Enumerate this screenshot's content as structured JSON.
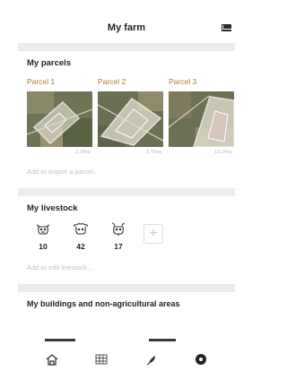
{
  "header": {
    "title": "My farm",
    "mail_icon": "mail-icon"
  },
  "parcels_section": {
    "title": "My parcels",
    "parcels": [
      {
        "name": "Parcel 1",
        "area": "2.24ha"
      },
      {
        "name": "Parcel 2",
        "area": "2.75ha"
      },
      {
        "name": "Parcel 3",
        "area": "10.24ha"
      }
    ],
    "add_link": "Add or import a parcel..."
  },
  "livestock_section": {
    "title": "My livestock",
    "animals": [
      {
        "icon": "cow-icon",
        "count": "10"
      },
      {
        "icon": "sheep-icon",
        "count": "42"
      },
      {
        "icon": "goat-icon",
        "count": "17"
      }
    ],
    "add_button": "+",
    "add_link": "Add or edit livestock..."
  },
  "buildings_section": {
    "title": "My buildings and non-agricultural areas"
  },
  "tabbar": {
    "icons": [
      "farm-home-icon",
      "calendar-grid-icon",
      "plant-icon",
      "settings-icon"
    ]
  },
  "colors": {
    "accent": "#b0772c",
    "divider": "#ececec",
    "muted": "#c3c3c3"
  }
}
